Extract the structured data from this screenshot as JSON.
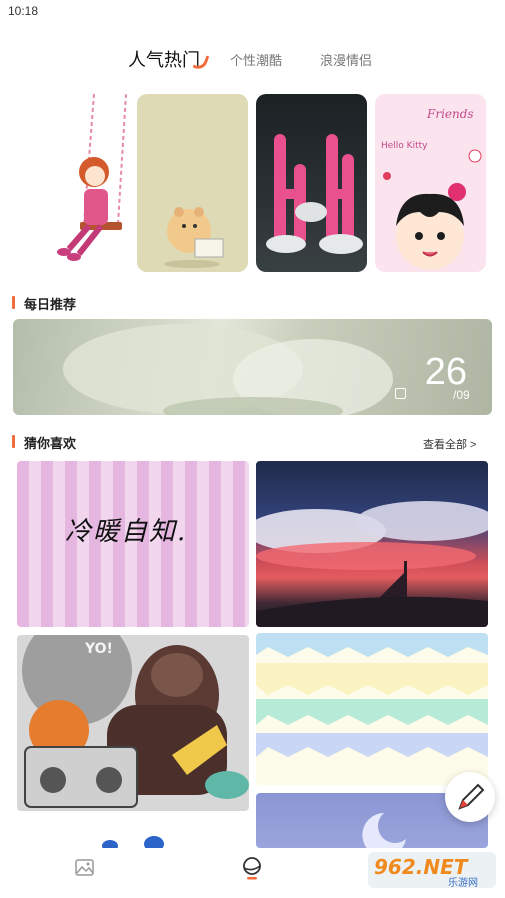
{
  "status_bar": {
    "time": "10:18"
  },
  "tabs": [
    {
      "label": "人气热门",
      "active": true
    },
    {
      "label": "个性潮酷",
      "active": false
    },
    {
      "label": "浪漫情侣",
      "active": false
    }
  ],
  "featured": [
    {
      "name": "girl-on-swing"
    },
    {
      "name": "hamster"
    },
    {
      "name": "pink-cactus"
    },
    {
      "name": "cartoon-girl"
    }
  ],
  "daily": {
    "title": "每日推荐",
    "day": "26",
    "month": "/09"
  },
  "recommend": {
    "title": "猜你喜欢",
    "view_all": "查看全部 >",
    "tile_text": "冷暖自知."
  },
  "artwork": {
    "hello_kitty": "Hello Kitty",
    "friends": "Friends",
    "yo": "YO!"
  },
  "watermark": {
    "text": "962.NET",
    "sub": "乐游网"
  },
  "colors": {
    "accent": "#f26b3a"
  }
}
